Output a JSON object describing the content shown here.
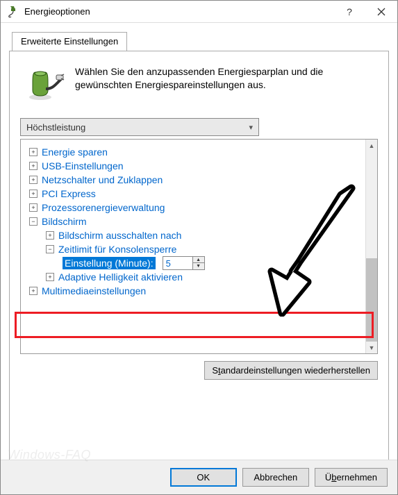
{
  "titlebar": {
    "title": "Energieoptionen"
  },
  "tab": {
    "label": "Erweiterte Einstellungen"
  },
  "intro": {
    "text": "Wählen Sie den anzupassenden Energiesparplan und die gewünschten Energiespareinstellungen aus."
  },
  "plan_combo": {
    "selected": "Höchstleistung"
  },
  "tree": {
    "items": [
      {
        "label": "Energie sparen",
        "expand": "+",
        "level": 0
      },
      {
        "label": "USB-Einstellungen",
        "expand": "+",
        "level": 0
      },
      {
        "label": "Netzschalter und Zuklappen",
        "expand": "+",
        "level": 0
      },
      {
        "label": "PCI Express",
        "expand": "+",
        "level": 0
      },
      {
        "label": "Prozessorenergieverwaltung",
        "expand": "+",
        "level": 0
      },
      {
        "label": "Bildschirm",
        "expand": "−",
        "level": 0
      },
      {
        "label": "Bildschirm ausschalten nach",
        "expand": "+",
        "level": 1
      },
      {
        "label": "Zeitlimit für Konsolensperre",
        "expand": "−",
        "level": 1
      },
      {
        "label": "Adaptive Helligkeit aktivieren",
        "expand": "+",
        "level": 1
      },
      {
        "label": "Multimediaeinstellungen",
        "expand": "+",
        "level": 0
      }
    ],
    "setting": {
      "label": "Einstellung (Minute):",
      "value": "5"
    }
  },
  "buttons": {
    "restore_pre": "S",
    "restore_u": "t",
    "restore_post": "andardeinstellungen wiederherstellen",
    "ok": "OK",
    "cancel": "Abbrechen",
    "apply_pre": "Ü",
    "apply_u": "b",
    "apply_post": "ernehmen"
  },
  "watermark": "Windows-FAQ"
}
